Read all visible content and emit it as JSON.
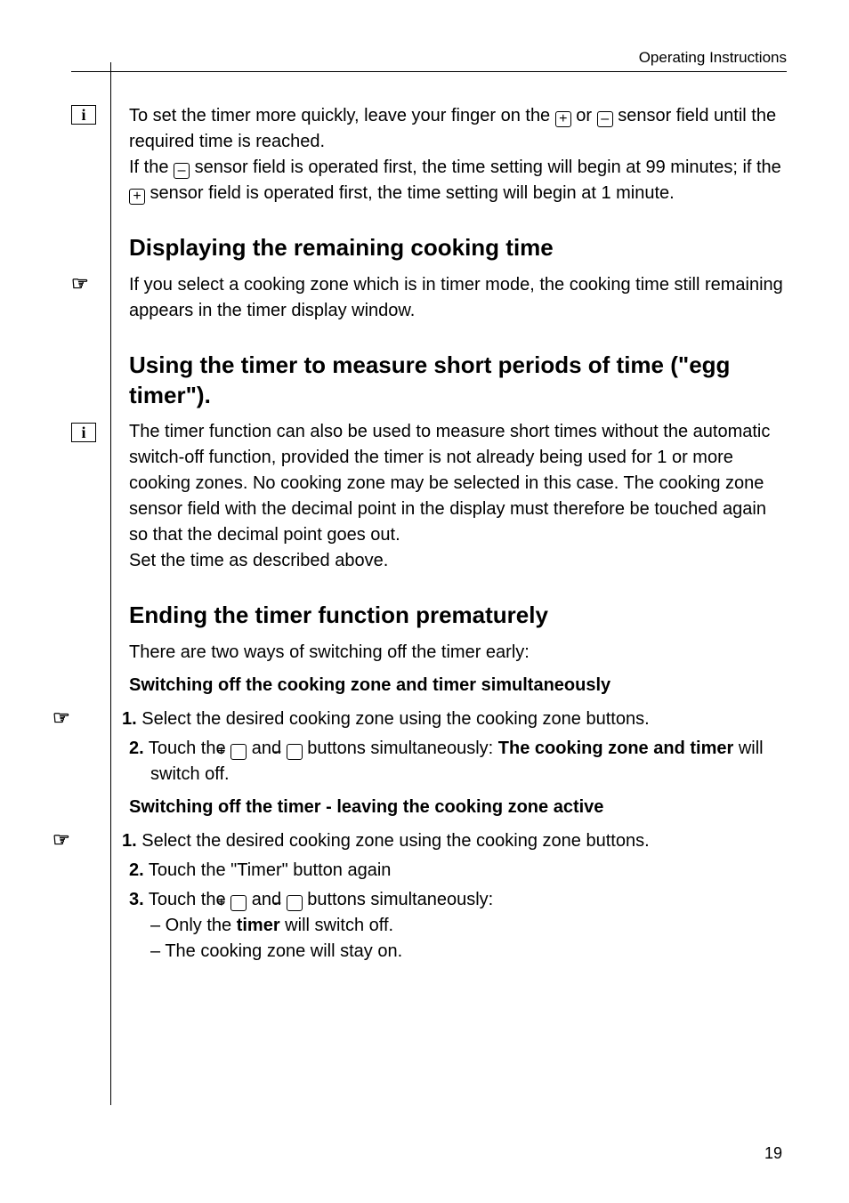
{
  "header": {
    "title": "Operating Instructions"
  },
  "block1": {
    "p1a": "To set the timer more quickly, leave your finger on the ",
    "p1b": " or ",
    "p1c": " sensor field until the required time is reached.",
    "p2a": "If the ",
    "p2b": " sensor field is operated first, the time setting will begin at 99 minutes; if the ",
    "p2c": " sensor field is operated first, the time setting will begin at 1 minute."
  },
  "block2": {
    "heading": "Displaying the remaining cooking time",
    "p1": "If you select a cooking zone which is in timer mode, the cooking time still remaining appears in the timer display window."
  },
  "block3": {
    "heading": "Using the timer to measure short periods of time (\"egg timer\").",
    "p1": "The timer function can also be used to measure short times without the automatic switch-off function, provided  the timer is not already being used for 1 or more cooking zones. No cooking zone may be selected in this case. The cooking zone sensor field with the decimal point in the display must therefore be touched again so that the decimal point goes out.",
    "p2": "Set the time as described above."
  },
  "block4": {
    "heading": "Ending the timer function prematurely",
    "intro": "There are two ways of switching off the timer early:",
    "sub1": "Switching off the cooking zone and timer simultaneously",
    "s1_pre": "1.",
    "s1": " Select the desired cooking zone using the cooking zone buttons.",
    "s2_pre": "2.",
    "s2a": " Touch the ",
    "s2b": " and ",
    "s2c": " buttons simultaneously: ",
    "s2d": "The cooking zone and timer",
    "s2e": " will switch off.",
    "sub2": "Switching off the timer - leaving the cooking zone active",
    "t1_pre": "1.",
    "t1": " Select the desired cooking zone using the cooking zone buttons.",
    "t2_pre": "2.",
    "t2": " Touch the \"Timer\" button again",
    "t3_pre": "3.",
    "t3a": " Touch the ",
    "t3b": " and ",
    "t3c": " buttons simultaneously:",
    "t3d": "– Only the ",
    "t3e": "timer",
    "t3f": " will switch off.",
    "t3g": "– The cooking zone will stay on."
  },
  "icons": {
    "plus": "+",
    "minus": "–",
    "hand": "☞",
    "info": "i"
  },
  "page": "19"
}
